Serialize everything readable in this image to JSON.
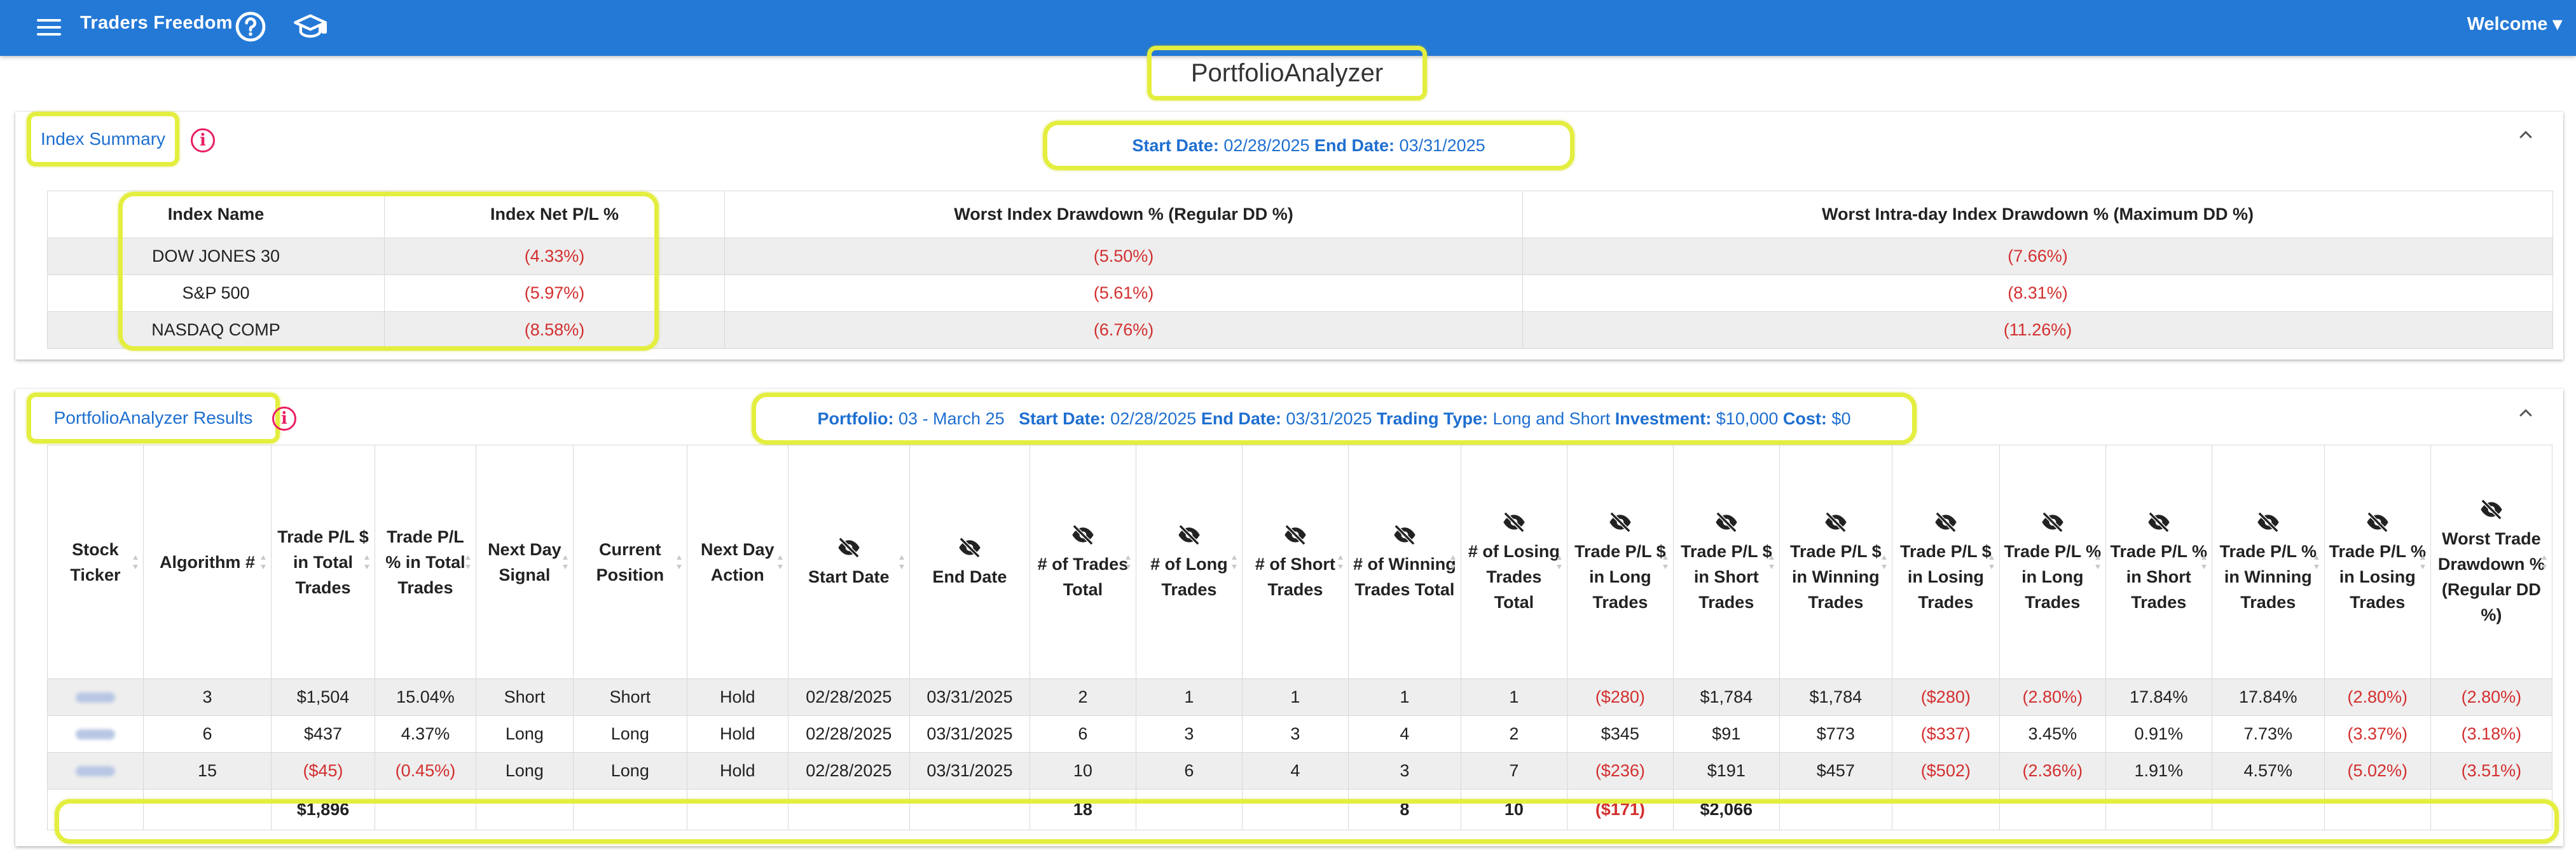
{
  "appbar": {
    "brand": "Traders Freedom",
    "welcome": "Welcome"
  },
  "page_title": "PortfolioAnalyzer",
  "index_summary": {
    "title": "Index Summary",
    "start_label": "Start Date:",
    "start_date": "02/28/2025",
    "end_label": "End Date:",
    "end_date": "03/31/2025",
    "headers": [
      "Index Name",
      "Index Net P/L %",
      "Worst Index Drawdown % (Regular DD %)",
      "Worst Intra-day Index Drawdown % (Maximum DD %)"
    ],
    "rows": [
      [
        "DOW JONES 30",
        "(4.33%)",
        "(5.50%)",
        "(7.66%)"
      ],
      [
        "S&P 500",
        "(5.97%)",
        "(5.61%)",
        "(8.31%)"
      ],
      [
        "NASDAQ COMP",
        "(8.58%)",
        "(6.76%)",
        "(11.26%)"
      ]
    ]
  },
  "results": {
    "title": "PortfolioAnalyzer Results",
    "portfolio_label": "Portfolio:",
    "portfolio": "03 - March 25",
    "start_label": "Start Date:",
    "start_date": "02/28/2025",
    "end_label": "End Date:",
    "end_date": "03/31/2025",
    "type_label": "Trading Type:",
    "type": "Long and Short",
    "investment_label": "Investment:",
    "investment": "$10,000",
    "cost_label": "Cost:",
    "cost": "$0",
    "headers": [
      "Stock Ticker",
      "Algorithm #",
      "Trade P/L $ in Total Trades",
      "Trade P/L % in Total Trades",
      "Next Day Signal",
      "Current Position",
      "Next Day Action",
      "Start Date",
      "End Date",
      "# of Trades Total",
      "# of Long Trades",
      "# of Short Trades",
      "# of Winning Trades Total",
      "# of Losing Trades Total",
      "Trade P/L $ in Long Trades",
      "Trade P/L $ in Short Trades",
      "Trade P/L $ in Winning Trades",
      "Trade P/L $ in Losing Trades",
      "Trade P/L % in Long Trades",
      "Trade P/L % in Short Trades",
      "Trade P/L % in Winning Trades",
      "Trade P/L % in Losing Trades",
      "Worst Trade Drawdown % (Regular DD %)"
    ],
    "rows": [
      [
        "",
        "3",
        "$1,504",
        "15.04%",
        "Short",
        "Short",
        "Hold",
        "02/28/2025",
        "03/31/2025",
        "2",
        "1",
        "1",
        "1",
        "1",
        "($280)",
        "$1,784",
        "$1,784",
        "($280)",
        "(2.80%)",
        "17.84%",
        "17.84%",
        "(2.80%)",
        "(2.80%)"
      ],
      [
        "",
        "6",
        "$437",
        "4.37%",
        "Long",
        "Long",
        "Hold",
        "02/28/2025",
        "03/31/2025",
        "6",
        "3",
        "3",
        "4",
        "2",
        "$345",
        "$91",
        "$773",
        "($337)",
        "3.45%",
        "0.91%",
        "7.73%",
        "(3.37%)",
        "(3.18%)"
      ],
      [
        "",
        "15",
        "($45)",
        "(0.45%)",
        "Long",
        "Long",
        "Hold",
        "02/28/2025",
        "03/31/2025",
        "10",
        "6",
        "4",
        "3",
        "7",
        "($236)",
        "$191",
        "$457",
        "($502)",
        "(2.36%)",
        "1.91%",
        "4.57%",
        "(5.02%)",
        "(3.51%)"
      ]
    ],
    "totals": [
      "",
      "",
      "$1,896",
      "",
      "",
      "",
      "",
      "",
      "",
      "18",
      "",
      "",
      "8",
      "10",
      "($171)",
      "$2,066",
      "",
      "",
      "",
      "",
      "",
      "",
      ""
    ]
  }
}
